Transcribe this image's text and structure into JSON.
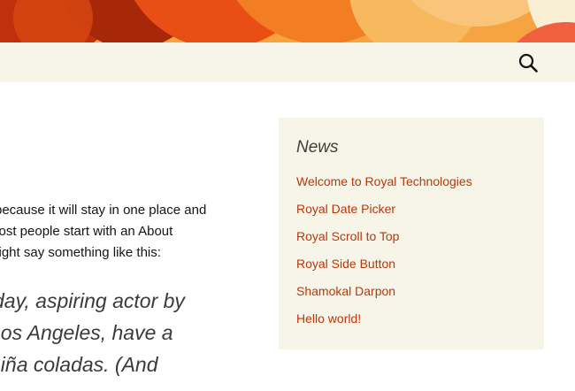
{
  "header": {
    "search_icon": "search-icon",
    "colors": {
      "navbar_bg": "#f7f5e7",
      "link": "#bc360a"
    }
  },
  "content": {
    "paragraph_lines": [
      "because it will stay in one place and",
      "Most people start with an About",
      "might say something like this:"
    ],
    "quote_lines": [
      "day, aspiring actor by",
      "Los Angeles, have a",
      "piña coladas. (And"
    ]
  },
  "sidebar": {
    "widget_title": "News",
    "items": [
      {
        "label": "Welcome to Royal Technologies"
      },
      {
        "label": "Royal Date Picker"
      },
      {
        "label": "Royal Scroll to Top"
      },
      {
        "label": "Royal Side Button"
      },
      {
        "label": "Shamokal Darpon"
      },
      {
        "label": "Hello world!"
      }
    ]
  }
}
